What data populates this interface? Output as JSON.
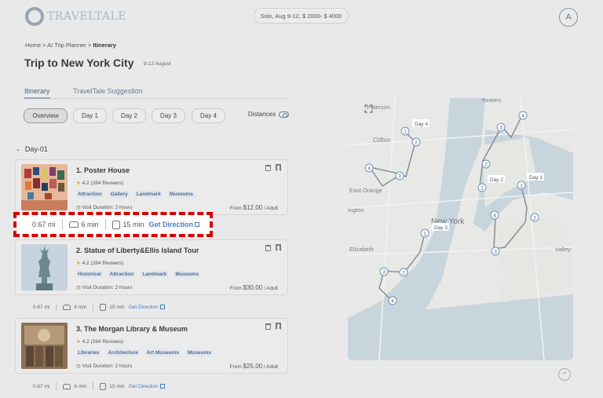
{
  "header": {
    "logo_text": "TRAVELTALE",
    "trip_summary": "Solo,  Aug 9-12,  $ 2000- $ 4000",
    "avatar_initial": "A"
  },
  "breadcrumb": {
    "home": "Home",
    "planner": "AI Trip Planner",
    "current": "Itinerary",
    "sep": ">"
  },
  "page": {
    "title": "Trip to New York City",
    "dates": "9-12 August"
  },
  "tabs": [
    {
      "label": "Itinerary",
      "active": true
    },
    {
      "label": "TravelTale Suggestion",
      "active": false
    }
  ],
  "day_chips": [
    {
      "label": "Overview",
      "active": true
    },
    {
      "label": "Day 1"
    },
    {
      "label": "Day 2"
    },
    {
      "label": "Day 3"
    },
    {
      "label": "Day 4"
    }
  ],
  "distances_label": "Distances",
  "day_section": {
    "label": "Day-01"
  },
  "places": [
    {
      "title": "1. Poster House",
      "rating": "4.2",
      "reviews": "(284 Reviews)",
      "tags": [
        "Attraction",
        "Gallery",
        "Landmark",
        "Museums"
      ],
      "duration": "Visit Duration: 2 hours",
      "price_prefix": "From",
      "price": "$12.00",
      "price_suffix": "/ Adult"
    },
    {
      "title": "2. Statue of Liberty&Ellis Island Tour",
      "rating": "4.2",
      "reviews": "(284 Reviews)",
      "tags": [
        "Historical",
        "Attraction",
        "Landmark",
        "Museums"
      ],
      "duration": "Visit Duration: 2 hours",
      "price_prefix": "From",
      "price": "$30.00",
      "price_suffix": "/ Adult"
    },
    {
      "title": "3. The Morgan Library & Museum",
      "rating": "4.2",
      "reviews": "(284 Reviews)",
      "tags": [
        "Libraries",
        "Architecture",
        "Art Museums",
        "Museums"
      ],
      "duration": "Visit Duration: 2 hours",
      "price_prefix": "From",
      "price": "$25.00",
      "price_suffix": "/ Adult"
    }
  ],
  "legs": [
    {
      "distance": "0.67 mi",
      "drive": "6 min",
      "transit": "15 min",
      "link": "Get Direction"
    },
    {
      "distance": "0.67 mi",
      "drive": "6 min",
      "transit": "15 min",
      "link": "Get Direction"
    },
    {
      "distance": "0.67 mi",
      "drive": "6 min",
      "transit": "15 min",
      "link": "Get Direction"
    }
  ],
  "map": {
    "labels": {
      "paterson": "Paterson",
      "yonkers": "Yonkers",
      "clifton": "Clifton",
      "east_orange": "East Orange",
      "ington": "ington",
      "new_york": "New York",
      "elizabeth": "Elizabeth",
      "valley": "Valley",
      "day1": "Day 1",
      "day2": "Day 2",
      "day3": "Day 3",
      "day4": "Day 4"
    },
    "pins": [
      "1",
      "2",
      "3",
      "4"
    ],
    "colors": {
      "route": "#8a8f96",
      "pin": "#6f8fc2",
      "water": "#c7d3da",
      "land": "#e8e9e6"
    }
  }
}
